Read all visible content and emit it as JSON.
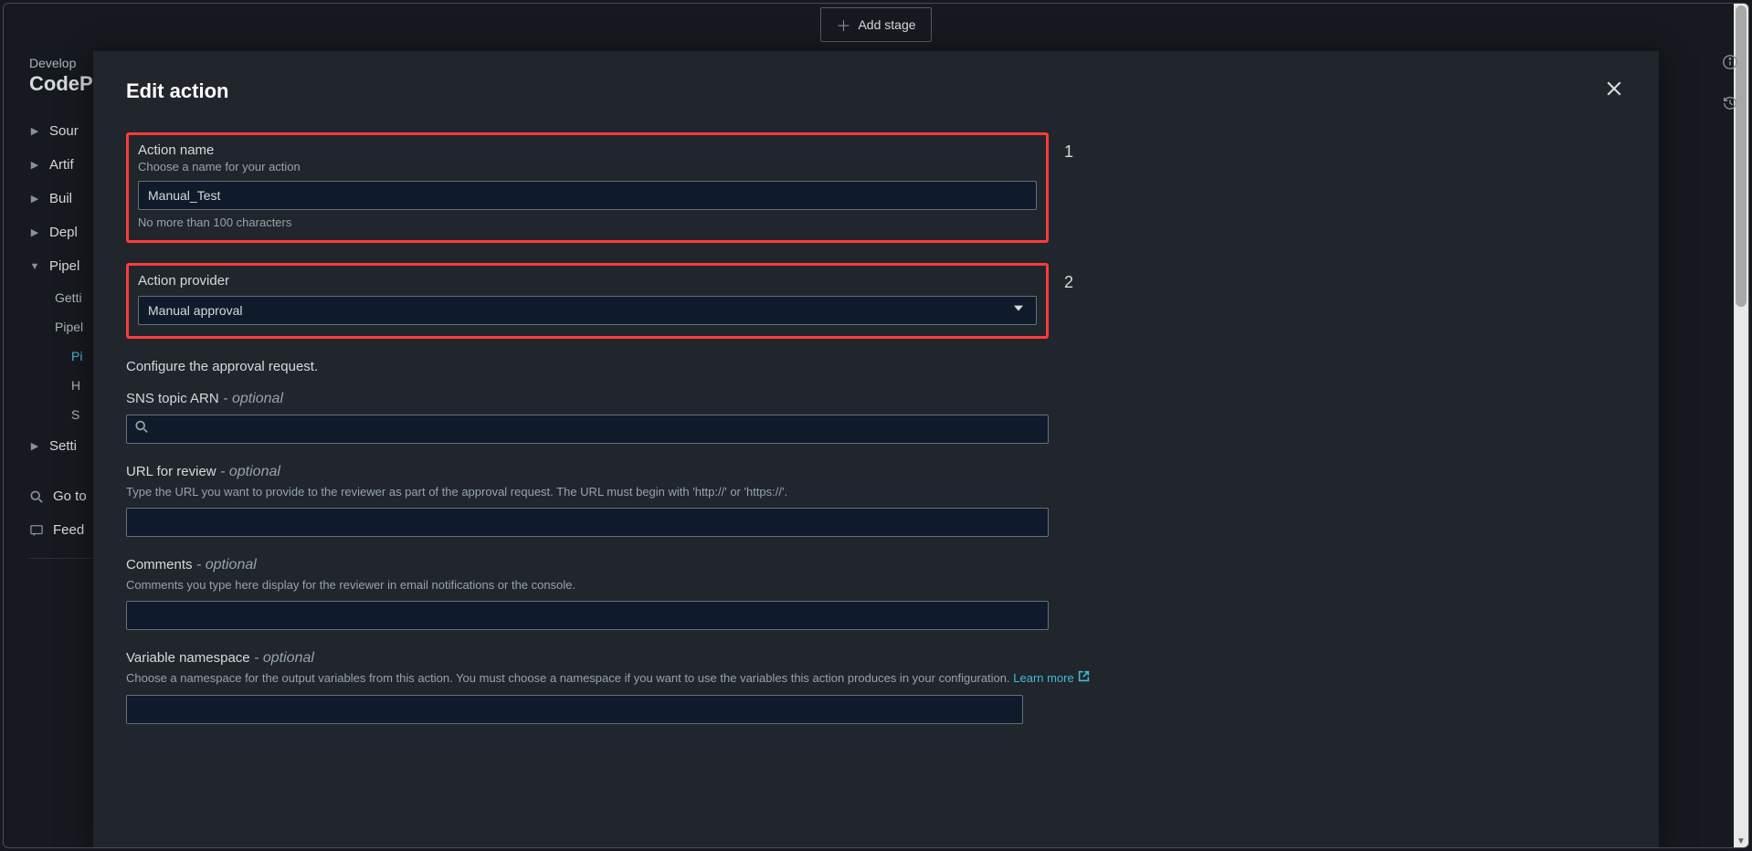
{
  "topbar": {
    "add_stage_label": "Add stage"
  },
  "breadcrumb": "Develop",
  "page_title_prefix": "CodeP",
  "sidebar": {
    "items": [
      {
        "label": "Sour",
        "expanded": false
      },
      {
        "label": "Artif",
        "expanded": false
      },
      {
        "label": "Buil",
        "expanded": false
      },
      {
        "label": "Depl",
        "expanded": false
      },
      {
        "label": "Pipel",
        "expanded": true
      }
    ],
    "sub_items": [
      {
        "label": "Getti"
      },
      {
        "label": "Pipel"
      },
      {
        "label": "Pi",
        "active": true
      },
      {
        "label": "H"
      },
      {
        "label": "S"
      }
    ],
    "settings_label": "Setti",
    "goto_label": "Go to",
    "feedback_label": "Feed"
  },
  "modal": {
    "title": "Edit action",
    "annot1": "1",
    "annot2": "2",
    "action_name": {
      "label": "Action name",
      "hint": "Choose a name for your action",
      "value": "Manual_Test",
      "constraint": "No more than 100 characters"
    },
    "action_provider": {
      "label": "Action provider",
      "value": "Manual approval"
    },
    "configure_text": "Configure the approval request.",
    "sns": {
      "label": "SNS topic ARN",
      "optional": "- optional"
    },
    "url_review": {
      "label": "URL for review",
      "optional": "- optional",
      "hint": "Type the URL you want to provide to the reviewer as part of the approval request. The URL must begin with 'http://' or 'https://'."
    },
    "comments": {
      "label": "Comments",
      "optional": "- optional",
      "hint": "Comments you type here display for the reviewer in email notifications or the console."
    },
    "var_ns": {
      "label": "Variable namespace",
      "optional": "- optional",
      "hint": "Choose a namespace for the output variables from this action. You must choose a namespace if you want to use the variables this action produces in your configuration.",
      "learn_more": "Learn more"
    }
  }
}
